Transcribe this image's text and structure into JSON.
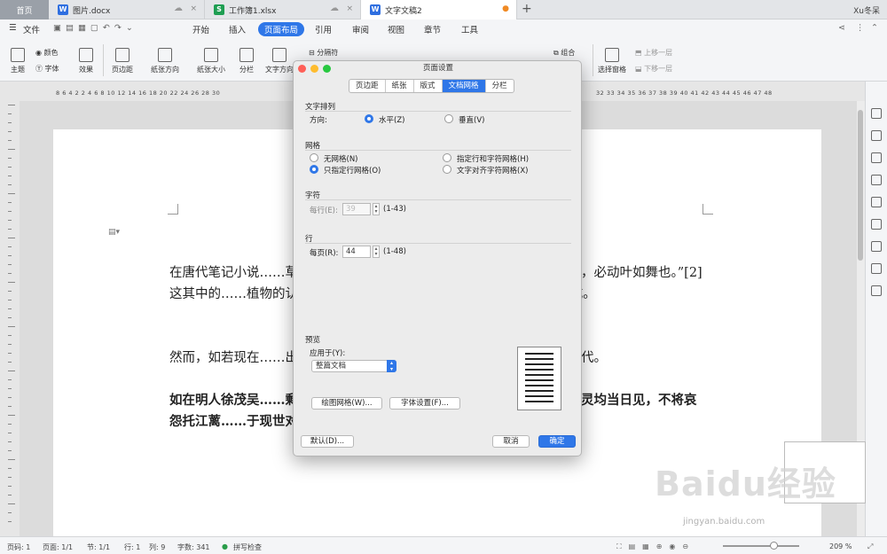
{
  "tabs": {
    "home": "首页",
    "docs": [
      {
        "name": "图片.docx",
        "color": "#2f6fe0",
        "glyph": "W"
      },
      {
        "name": "工作簿1.xlsx",
        "color": "#1e9e52",
        "glyph": "S"
      },
      {
        "name": "文字文稿2",
        "color": "#2f6fe0",
        "glyph": "W"
      }
    ],
    "new_tab": "+",
    "user": "Xu冬呆"
  },
  "menu": {
    "file": "文件",
    "items": [
      "开始",
      "插入",
      "页面布局",
      "引用",
      "审阅",
      "视图",
      "章节",
      "工具"
    ],
    "active": "页面布局"
  },
  "ribbon": {
    "theme": "主题",
    "colors": "颜色",
    "fonts": "字体",
    "effects": "效果",
    "margins": "页边距",
    "orientation": "纸张方向",
    "size": "纸张大小",
    "columns": "分栏",
    "text_direction": "文字方向",
    "breaks": "分隔符",
    "group": "组合",
    "selection_pane": "选择窗格",
    "bring_forward": "上移一层",
    "send_backward": "下移一层"
  },
  "ruler": {
    "left": "8 6 4 2 2 4 6 8 10 12 14 16 18 20 22 24 26 28 30",
    "right": "32 33 34 35 36 37 38 39 40 41 42 43 44 45 46 47 48"
  },
  "document": {
    "p1": "在唐代笔记小说……草，出雅州。独茎三叶，叶如决明。一……纸掌讴曲，必动叶如舞也。”[2]这其中的……植物的认知颇为相似：舞草高 60-200 ……有三片小叶组成。",
    "p2": "然而，如若现在……出现另一种罂粟科罂粟属草本植物的介绍……溯到明代。",
    "p3": "如在明人徐茂吴……剩有芳名寄一枝。浥露晚妆余涕泪，临……葵。若使灵均当日见，不将哀怨托江蓠……于现世对于它的认知和理解。"
  },
  "dialog": {
    "title": "页面设置",
    "tabs": [
      "页边距",
      "纸张",
      "版式",
      "文档网格",
      "分栏"
    ],
    "active_tab": "文档网格",
    "text_flow": {
      "header": "文字排列",
      "direction_label": "方向:",
      "horizontal": "水平(Z)",
      "vertical": "垂直(V)",
      "selected": "水平(Z)"
    },
    "grid": {
      "header": "网格",
      "options": [
        "无网格(N)",
        "指定行和字符网格(H)",
        "只指定行网格(O)",
        "文字对齐字符网格(X)"
      ],
      "selected": "只指定行网格(O)"
    },
    "chars": {
      "header": "字符",
      "per_line_label": "每行(E):",
      "per_line_value": "39",
      "range": "(1-43)"
    },
    "lines": {
      "header": "行",
      "per_page_label": "每页(R):",
      "per_page_value": "44",
      "range": "(1-48)"
    },
    "preview": {
      "header": "预览",
      "apply_label": "应用于(Y):",
      "apply_value": "整篇文档"
    },
    "buttons": {
      "draw_grid": "绘图网格(W)...",
      "font_settings": "字体设置(F)...",
      "default": "默认(D)...",
      "cancel": "取消",
      "ok": "确定"
    }
  },
  "status": {
    "page_num": "页码: 1",
    "pages": "页面: 1/1",
    "section": "节: 1/1",
    "line": "行: 1",
    "col": "列: 9",
    "words": "字数: 341",
    "spell": "拼写检查",
    "zoom": "209 %"
  },
  "watermark": {
    "logo": "Baidu经验",
    "url": "jingyan.baidu.com"
  },
  "colors": {
    "accent": "#2f77e8",
    "close_red": "#ff5f57",
    "minimize_yellow": "#febc2e",
    "zoom_green": "#28c840"
  }
}
